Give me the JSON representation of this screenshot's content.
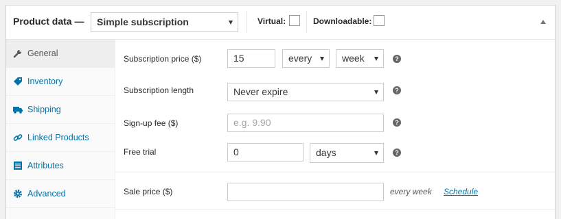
{
  "header": {
    "title": "Product data —",
    "product_type": "Simple subscription",
    "virtual_label": "Virtual:",
    "downloadable_label": "Downloadable:"
  },
  "tabs": [
    {
      "label": "General",
      "icon": "wrench-icon",
      "active": true
    },
    {
      "label": "Inventory",
      "icon": "tag-icon"
    },
    {
      "label": "Shipping",
      "icon": "truck-icon"
    },
    {
      "label": "Linked Products",
      "icon": "link-icon"
    },
    {
      "label": "Attributes",
      "icon": "list-icon"
    },
    {
      "label": "Advanced",
      "icon": "gear-icon"
    }
  ],
  "fields": {
    "price_label": "Subscription price ($)",
    "price_value": "15",
    "interval_value": "every",
    "period_value": "week",
    "length_label": "Subscription length",
    "length_value": "Never expire",
    "signup_label": "Sign-up fee ($)",
    "signup_placeholder": "e.g. 9.90",
    "trial_label": "Free trial",
    "trial_value": "0",
    "trial_period": "days",
    "sale_label": "Sale price ($)",
    "sale_note": "every week",
    "schedule_link": "Schedule",
    "help_glyph": "?"
  },
  "colors": {
    "link": "#0073aa",
    "help_bg": "#666666",
    "active_tab_bg": "#eeeeee"
  }
}
